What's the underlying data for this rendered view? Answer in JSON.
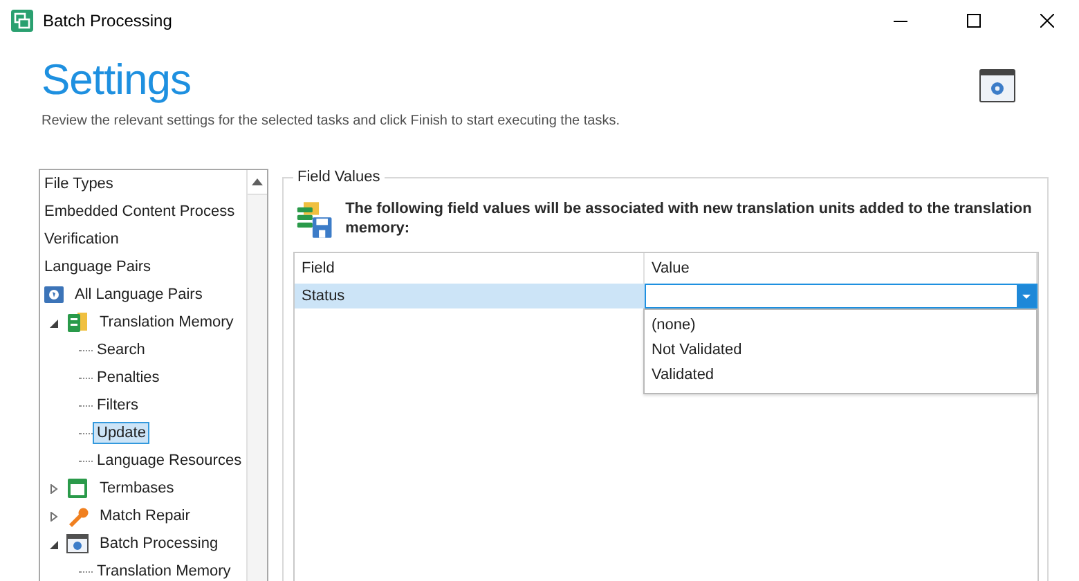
{
  "window": {
    "title": "Batch Processing"
  },
  "header": {
    "title": "Settings",
    "subtitle": "Review the relevant settings for the selected tasks and click Finish to start executing the tasks."
  },
  "tree": {
    "items": [
      {
        "label": "File Types",
        "selected": false
      },
      {
        "label": "Embedded Content Process",
        "selected": false
      },
      {
        "label": "Verification",
        "selected": false
      },
      {
        "label": "Language Pairs",
        "selected": false
      },
      {
        "label": "All Language Pairs",
        "kind": "globe",
        "selected": false,
        "children": [
          {
            "label": "Translation Memory",
            "kind": "memory",
            "selected": false,
            "expanded": true,
            "children": [
              {
                "label": "Search",
                "selected": false
              },
              {
                "label": "Penalties",
                "selected": false
              },
              {
                "label": "Filters",
                "selected": false
              },
              {
                "label": "Update",
                "selected": true
              },
              {
                "label": "Language Resources",
                "selected": false
              }
            ]
          },
          {
            "label": "Termbases",
            "kind": "termbase",
            "selected": false,
            "expanded": false
          },
          {
            "label": "Match Repair",
            "kind": "wrench",
            "selected": false,
            "expanded": false
          },
          {
            "label": "Batch Processing",
            "kind": "batch",
            "selected": false,
            "expanded": true,
            "children": [
              {
                "label": "Translation Memory",
                "selected": false
              }
            ]
          }
        ]
      }
    ]
  },
  "group": {
    "title": "Field Values",
    "description": "The following field values will be associated with new translation units added to the translation memory:",
    "table": {
      "columns": [
        "Field",
        "Value"
      ],
      "rows": [
        {
          "field": "Status",
          "value": "",
          "selected": true,
          "dropdown": {
            "open": true,
            "options": [
              "(none)",
              "Not Validated",
              "Validated"
            ]
          }
        }
      ]
    }
  }
}
